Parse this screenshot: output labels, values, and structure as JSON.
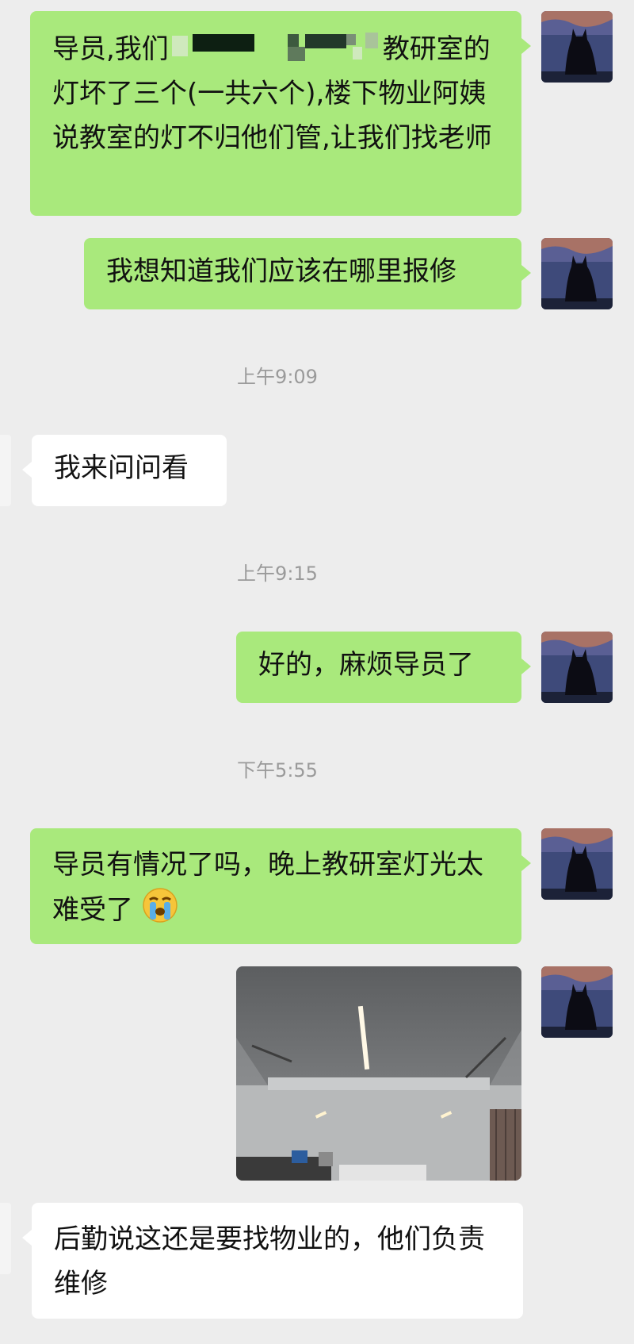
{
  "messages": {
    "m1": {
      "prefix": "导员,我们",
      "suffix": "教研室的灯坏了三个(一共六个),楼下物业阿姨说教室的灯不归他们管,让我们找老师"
    },
    "m2": {
      "text": "我想知道我们应该在哪里报修"
    },
    "ts1": "上午9:09",
    "m3": {
      "text": "我来问问看"
    },
    "ts2": "上午9:15",
    "m4": {
      "text": "好的，麻烦导员了"
    },
    "ts3": "下午5:55",
    "m5": {
      "text": "导员有情况了吗，晚上教研室灯光太难受了"
    },
    "m5_emoji": "crying-face-icon",
    "m6_image": "classroom-ceiling-lights-photo",
    "m7": {
      "text": "后勤说这还是要找物业的，他们负责维修"
    }
  },
  "colors": {
    "background": "#ededed",
    "bubble_mine": "#a9e97c",
    "bubble_theirs": "#ffffff",
    "timestamp": "#9a9a9a"
  }
}
